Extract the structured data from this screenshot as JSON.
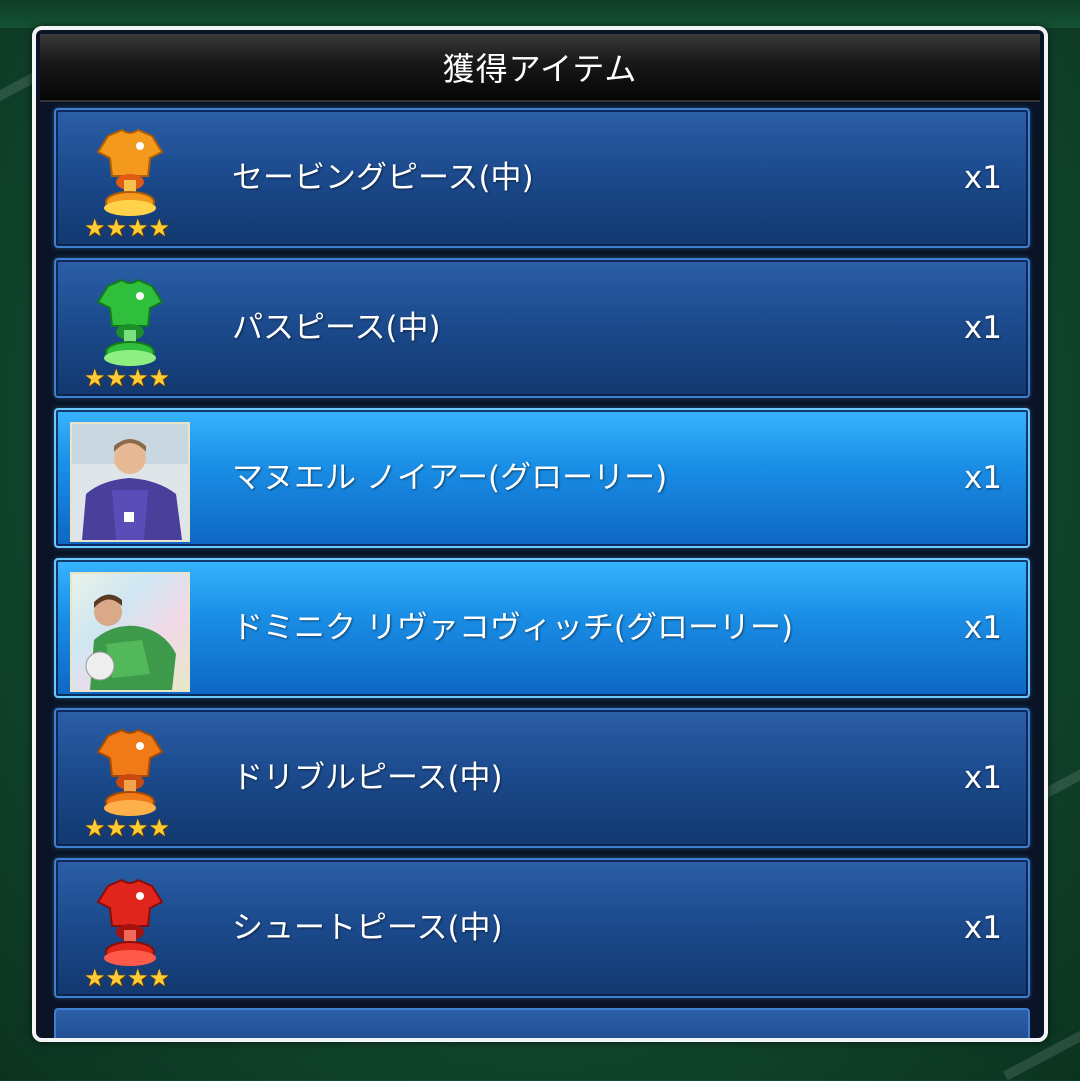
{
  "dialog": {
    "title": "獲得アイテム"
  },
  "items": [
    {
      "name": "セービングピース(中)",
      "qty": "x1",
      "icon": "jersey-trophy-icon",
      "color": "#f39a1e",
      "stars": "★★★★"
    },
    {
      "name": "パスピース(中)",
      "qty": "x1",
      "icon": "jersey-trophy-icon",
      "color": "#2fbf3c",
      "stars": "★★★★"
    },
    {
      "name": "マヌエル ノイアー(グローリー)",
      "qty": "x1",
      "icon": "player-card-icon"
    },
    {
      "name": "ドミニク リヴァコヴィッチ(グローリー)",
      "qty": "x1",
      "icon": "player-card-icon"
    },
    {
      "name": "ドリブルピース(中)",
      "qty": "x1",
      "icon": "jersey-trophy-icon",
      "color": "#f07a18",
      "stars": "★★★★"
    },
    {
      "name": "シュートピース(中)",
      "qty": "x1",
      "icon": "jersey-trophy-icon",
      "color": "#e0251c",
      "stars": "★★★★"
    }
  ]
}
